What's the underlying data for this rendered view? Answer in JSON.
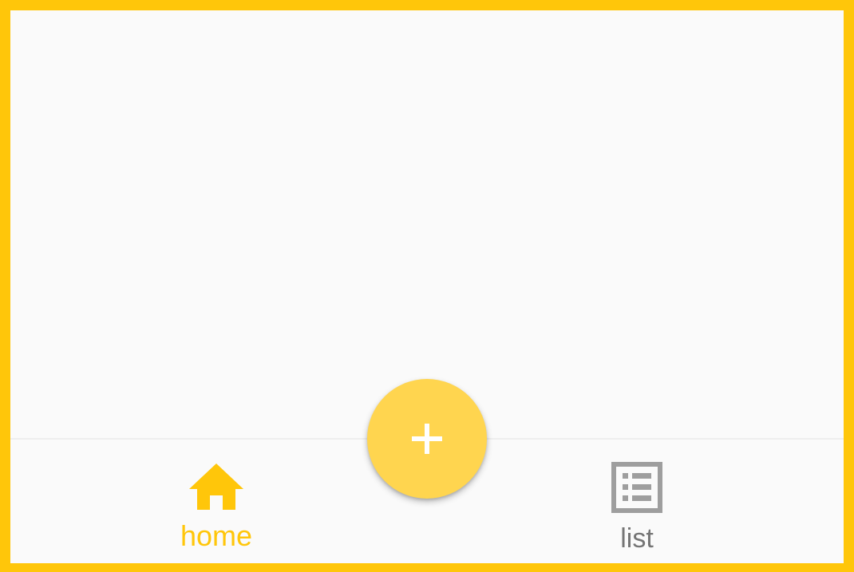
{
  "colors": {
    "accent": "#FFC60A",
    "fab": "#FFD54F",
    "inactive": "#757575",
    "background": "#FAFAFA"
  },
  "fab": {
    "icon": "plus-icon"
  },
  "bottom_nav": {
    "items": [
      {
        "label": "home",
        "icon": "home-icon",
        "active": true
      },
      {
        "label": "list",
        "icon": "list-icon",
        "active": false
      }
    ]
  }
}
